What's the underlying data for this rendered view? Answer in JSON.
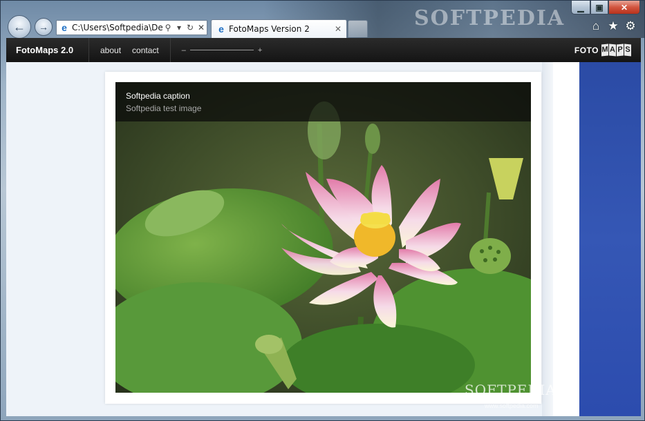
{
  "browser": {
    "address_text": "C:\\Users\\Softpedia\\Des",
    "tabs": [
      {
        "label": "FotoMaps Version 2"
      }
    ],
    "watermark_top": "SOFTPEDIA"
  },
  "site": {
    "brand": "FotoMaps 2.0",
    "nav": [
      {
        "label": "about"
      },
      {
        "label": "contact"
      }
    ],
    "zoom": {
      "minus": "–",
      "plus": "+"
    },
    "logo": {
      "prefix": "FOTO",
      "letters": [
        "M",
        "A",
        "P",
        "S"
      ]
    }
  },
  "photo": {
    "caption_title": "Softpedia caption",
    "caption_subtitle": "Softpedia test image"
  },
  "watermark": {
    "brand": "SOFTPEDIA",
    "url": "www.softpedia.com"
  },
  "colors": {
    "sitebar": "#1a1a1a",
    "page_bg": "#eef3f9",
    "blue_strip": "#3252b0",
    "close_button": "#c9432b"
  }
}
